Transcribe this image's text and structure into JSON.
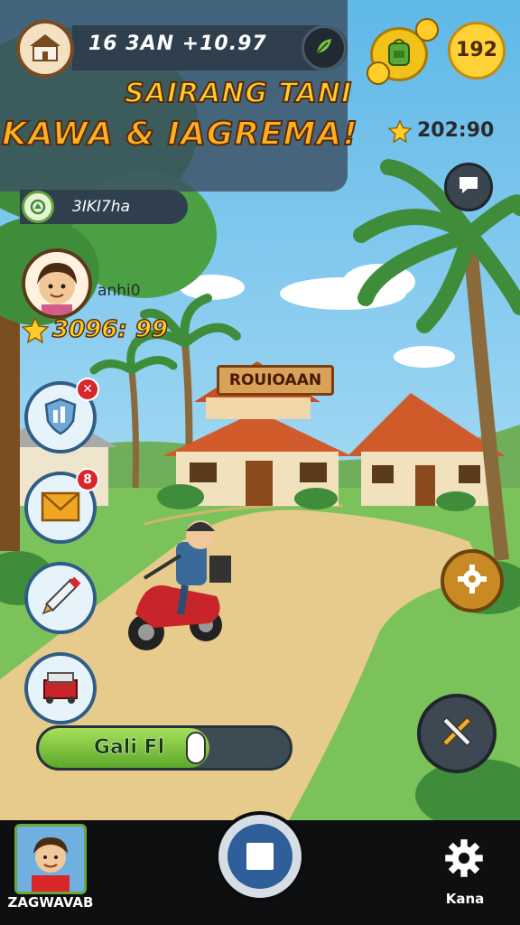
{
  "header": {
    "info_text": "16 3AN +10.97",
    "title_line1": "SAIRANG TANI",
    "title_line2": "KAWA & IAGREMA!"
  },
  "badge": {
    "text": "3IKI7ha"
  },
  "player": {
    "name": "anhi0",
    "score": "3096: 99"
  },
  "side_buttons": [
    {
      "badge": "✕"
    },
    {
      "badge": "8"
    },
    {
      "badge": ""
    },
    {
      "badge": ""
    }
  ],
  "progress": {
    "label": "Gali Fl",
    "fraction": 0.68
  },
  "top_right": {
    "coins": "192",
    "star_score": "202:90"
  },
  "scene": {
    "house_sign": "ROUIOAAN"
  },
  "bottom_nav": {
    "profile_label": "ZAGWAVAB",
    "settings_label": "Kana"
  },
  "colors": {
    "accent_gold": "#ffcc2a",
    "panel": "#2f3f4d",
    "nav_bg": "#0e0f10",
    "primary_blue": "#2e5f9a"
  },
  "icons": [
    "house-icon",
    "leaf-icon",
    "badge-icon",
    "shield-icon",
    "envelope-icon",
    "pencil-icon",
    "toolbox-icon",
    "backpack-icon",
    "star-icon",
    "chat-icon",
    "gear-icon",
    "tools-icon",
    "stop-icon"
  ]
}
